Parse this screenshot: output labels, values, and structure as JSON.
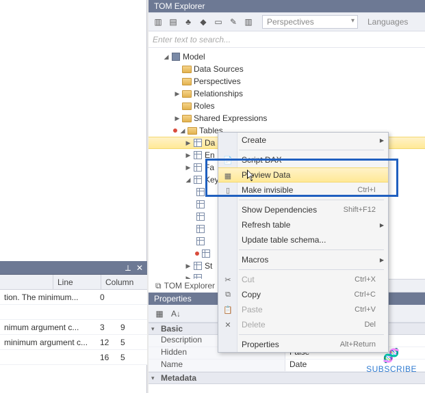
{
  "panel_title": "TOM Explorer",
  "toolbar": {
    "perspectives_label": "Perspectives",
    "languages_label": "Languages"
  },
  "search": {
    "placeholder": "Enter text to search..."
  },
  "tree": {
    "root": "Model",
    "nodes": {
      "data_sources": "Data Sources",
      "perspectives": "Perspectives",
      "relationships": "Relationships",
      "roles": "Roles",
      "shared_expressions": "Shared Expressions",
      "tables": "Tables"
    },
    "tables": {
      "t0": "Da",
      "t1": "En",
      "t2": "Fa",
      "t3": "Key",
      "t10": "St"
    }
  },
  "context_menu": {
    "create": "Create",
    "script_dax": "Script DAX",
    "preview_data": "Preview Data",
    "make_invisible": "Make invisible",
    "make_invisible_shortcut": "Ctrl+I",
    "show_deps": "Show Dependencies",
    "show_deps_shortcut": "Shift+F12",
    "refresh_table": "Refresh table",
    "update_schema": "Update table schema...",
    "macros": "Macros",
    "cut": "Cut",
    "cut_shortcut": "Ctrl+X",
    "copy": "Copy",
    "copy_shortcut": "Ctrl+C",
    "paste": "Paste",
    "paste_shortcut": "Ctrl+V",
    "delete": "Delete",
    "delete_shortcut": "Del",
    "properties": "Properties",
    "properties_shortcut": "Alt+Return"
  },
  "tabs": {
    "tom": "TOM Explorer"
  },
  "properties": {
    "title": "Properties",
    "groups": {
      "basic": "Basic",
      "metadata": "Metadata"
    },
    "rows": {
      "description": "Description",
      "hidden_key": "Hidden",
      "hidden_val": "False",
      "name_key": "Name",
      "name_val": "Date"
    }
  },
  "left_grid": {
    "cols": {
      "line": "Line",
      "column": "Column"
    },
    "rows": [
      {
        "a": "tion. The minimum...",
        "b": "0",
        "c": ""
      },
      {
        "a": "",
        "b": "",
        "c": ""
      },
      {
        "a": "nimum argument c...",
        "b": "3",
        "c": "9"
      },
      {
        "a": "minimum argument c...",
        "b": "12",
        "c": "5"
      },
      {
        "a": "",
        "b": "16",
        "c": "5"
      }
    ]
  },
  "subscribe": "SUBSCRIBE"
}
